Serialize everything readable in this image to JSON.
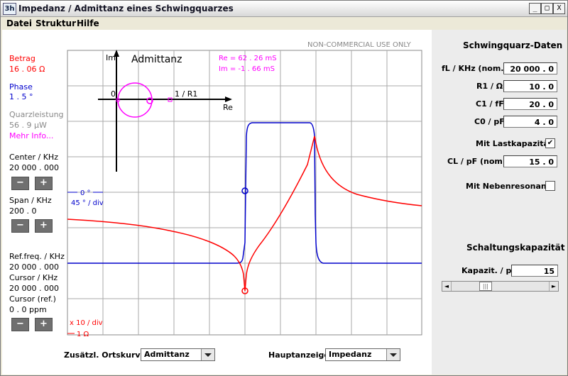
{
  "window": {
    "title": "Impedanz / Admittanz eines Schwingquarzes",
    "icon_text": "3h",
    "btn_min": "_",
    "btn_max": "□",
    "btn_close": "X"
  },
  "menu": [
    "Datei",
    "Struktur",
    "Hilfe"
  ],
  "left": {
    "betrag_label": "Betrag",
    "betrag_value": "16 . 06 Ω",
    "phase_label": "Phase",
    "phase_value": "1 . 5 °",
    "quarz_label": "Quarzleistung",
    "quarz_value": "56 . 9 µW",
    "more_info": "Mehr Info...",
    "center_label": "Center / KHz",
    "center_value": "20 000 . 000",
    "span_label": "Span / KHz",
    "span_value": "200 . 0",
    "reffreq_label": "Ref.freq. / KHz",
    "reffreq_value": "20 000 . 000",
    "cursor_label": "Cursor / KHz",
    "cursor_value": "20 000 . 000",
    "cursor_ref_label": "Cursor (ref.)",
    "cursor_ref_value": "0 . 0 ppm",
    "minus": "−",
    "plus": "+"
  },
  "plot": {
    "watermark": "NON-COMMERCIAL USE ONLY",
    "inset_title": "Admittanz",
    "inset_im": "Im",
    "inset_re": "Re",
    "inset_zero": "0",
    "inset_r1": "1 / R1",
    "re_readout": "Re = 62 . 26 mS",
    "im_readout": "Im = -1 . 66 mS",
    "phase_zero": "0 °",
    "phase_scale": "45 ° / div",
    "mag_scale": "x 10 / div",
    "mag_ref": "1 Ω",
    "colors": {
      "magnitude": "#ff0000",
      "phase": "#0000cc",
      "admittance": "#ff00ff",
      "grid": "#a8a8a8"
    }
  },
  "bottom": {
    "ortskurve_label": "Zusätzl. Ortskurve",
    "ortskurve_value": "Admittanz",
    "haupt_label": "Hauptanzeige",
    "haupt_value": "Impedanz"
  },
  "right": {
    "section1": "Schwingquarz-Daten",
    "fl_label": "fL / KHz (nom.)",
    "fl_value": "20 000 . 0",
    "r1_label": "R1 / Ω",
    "r1_value": "10 . 0",
    "c1_label": "C1 / fF",
    "c1_value": "20 . 0",
    "c0_label": "C0 / pF",
    "c0_value": "4 . 0",
    "lastkap_label": "Mit Lastkapazität",
    "lastkap_checked": "✔",
    "cl_label": "CL / pF (nom.)",
    "cl_value": "15 . 0",
    "neben_label": "Mit Nebenresonanz",
    "section2": "Schaltungskapazität",
    "kap_label": "Kapazit. / pF",
    "kap_value": "15",
    "slider_fraction": 0.33,
    "scroll_left": "◄",
    "scroll_right": "►"
  }
}
